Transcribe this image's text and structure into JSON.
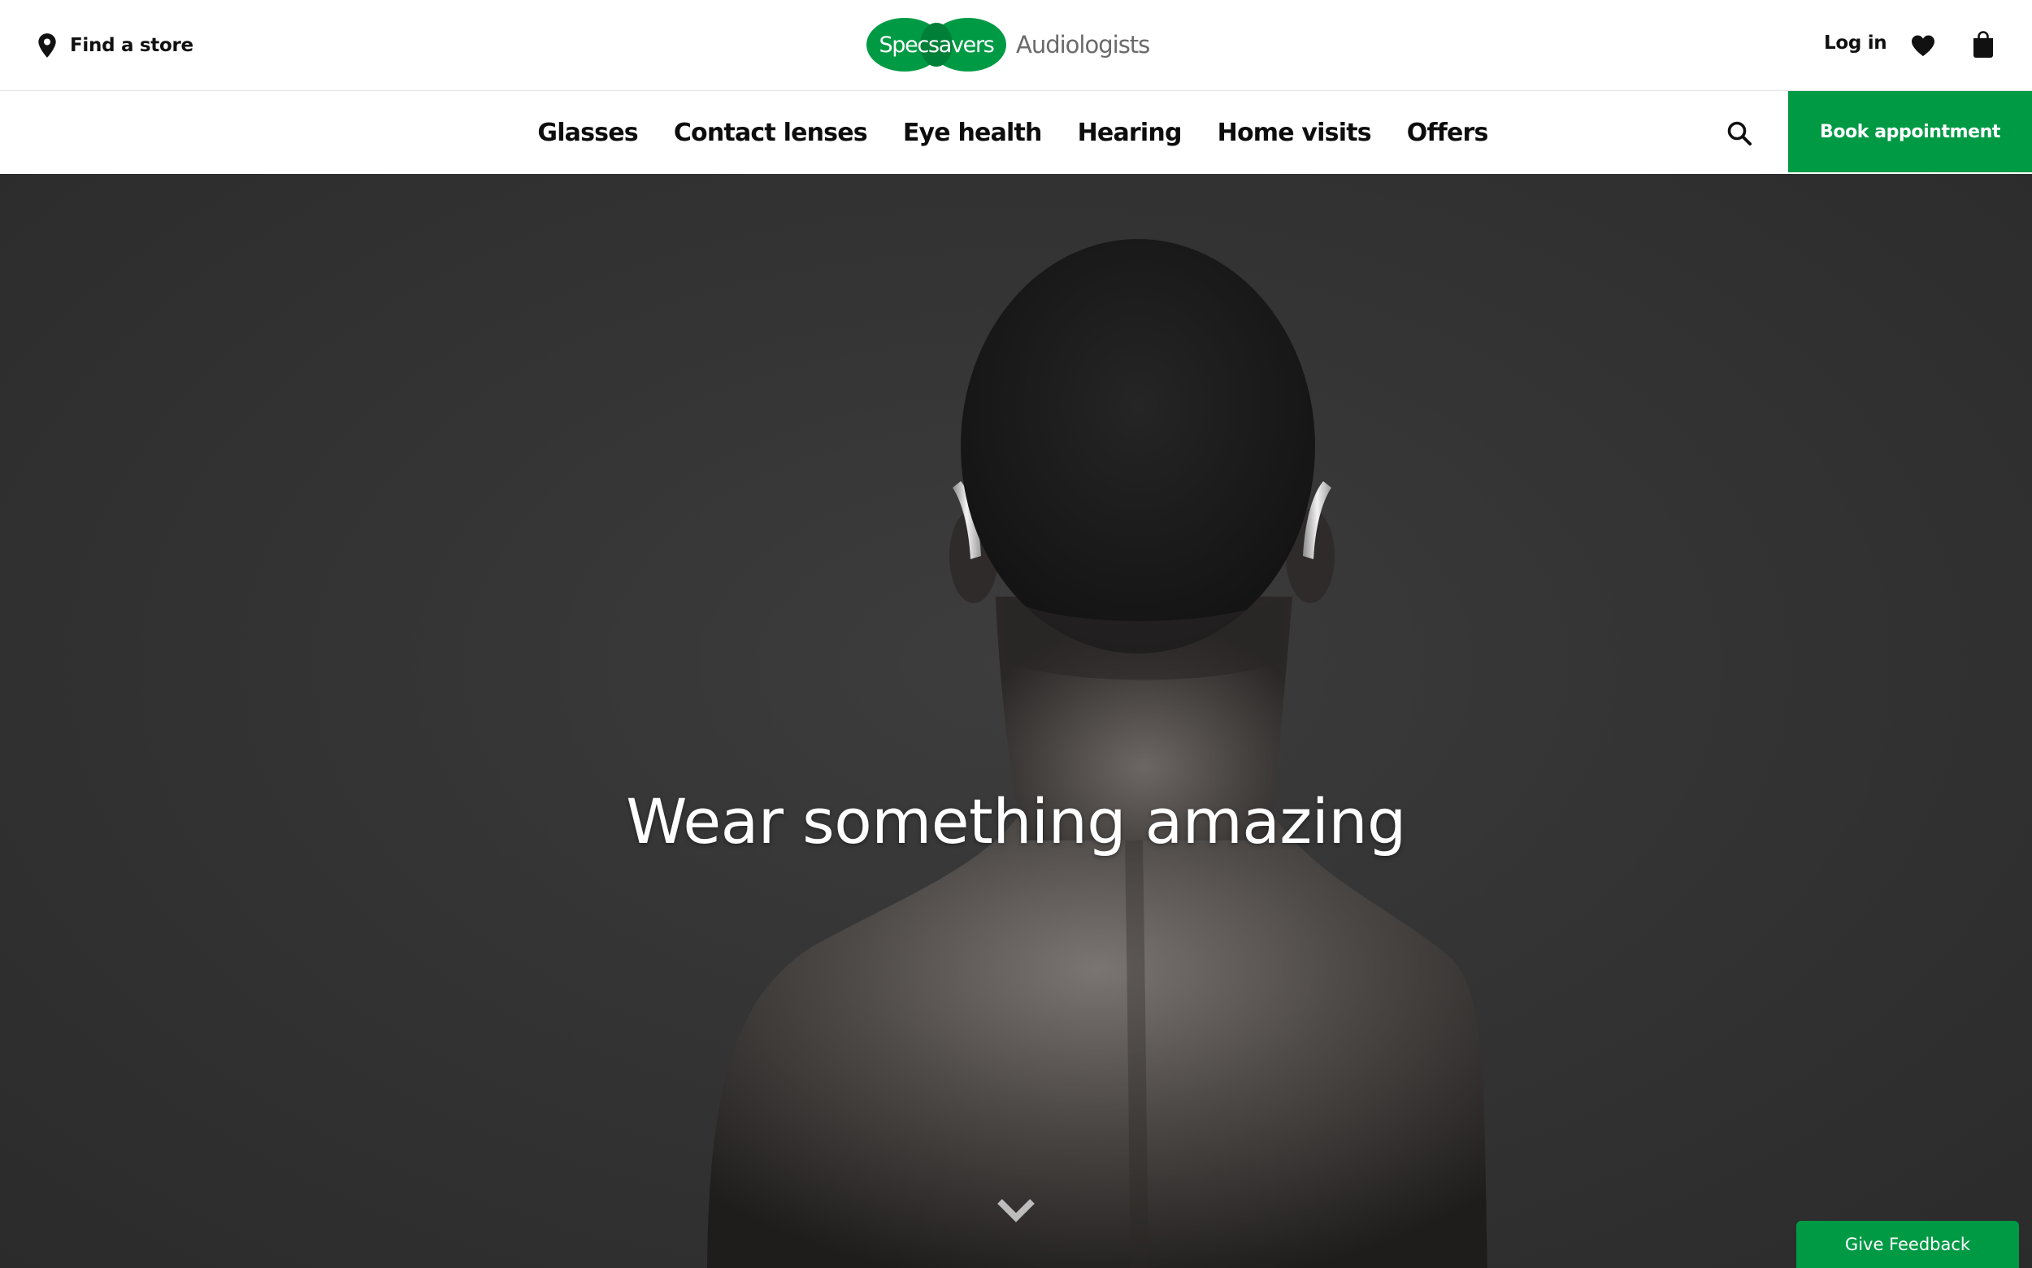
{
  "header": {
    "find_store_label": "Find a store",
    "logo_brand": "Specsavers",
    "logo_sub": "Audiologists",
    "login_label": "Log in"
  },
  "nav": {
    "items": [
      "Glasses",
      "Contact lenses",
      "Eye health",
      "Hearing",
      "Home visits",
      "Offers"
    ],
    "book_label": "Book appointment"
  },
  "hero": {
    "title": "Wear something amazing"
  },
  "feedback": {
    "label": "Give Feedback"
  },
  "icons": {
    "find_store": "location-pin-icon",
    "wishlist": "heart-icon",
    "basket": "shopping-bag-icon",
    "search": "search-icon",
    "scroll": "chevron-down-icon"
  },
  "colors": {
    "brand_green": "#009a45",
    "brand_green_dark": "#007f38",
    "hero_background": "#343434",
    "text_dark": "#111111"
  }
}
